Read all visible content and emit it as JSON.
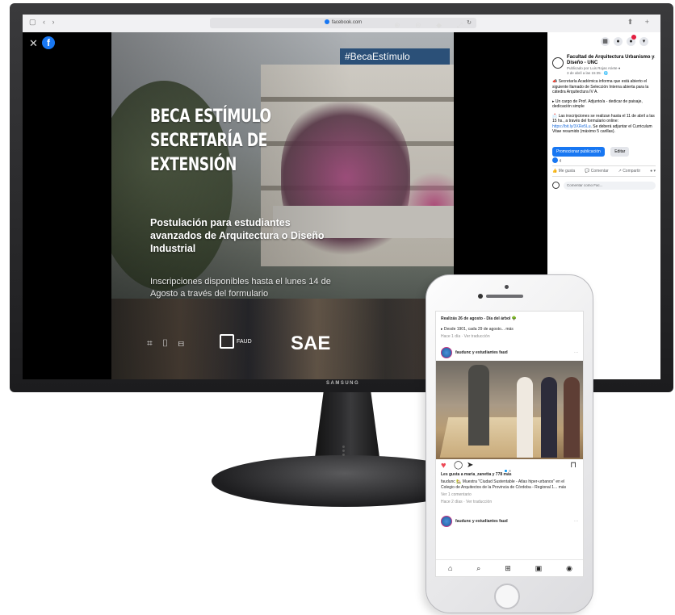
{
  "browser": {
    "url": "facebook.com",
    "nav_icons": "▢ ‹ ›",
    "right_icons": "⬆ +"
  },
  "viewer": {
    "close_icon": "✕",
    "logo_letter": "f",
    "zoom_icons": "⊕ ⊖ ◆ ⤢",
    "hashtag": "#BecaEstímulo",
    "title_lines": [
      "BECA ESTÍMULO",
      "SECRETARÍA DE",
      "EXTENSIÓN"
    ],
    "subtitle": "Postulación para estudiantes avanzados de Arquitectura o Diseño Industrial",
    "inscription": "Inscripciones disponibles hasta el lunes 14 de Agosto a través del formulario",
    "logos_left": "⌗ ▯ ⊟",
    "falo_label": "FAUD",
    "sae_label": "SAE"
  },
  "sidebar": {
    "top_icons": [
      "▦",
      "●",
      "●",
      "▾"
    ],
    "page_name": "Facultad de Arquitectura Urbanismo y Diseño - UNC",
    "post_meta_1": "Publicado por Luis Rojas Ariete ●",
    "post_meta_2": "3 de abril a las 15:35 · 🌐",
    "more": "···",
    "paragraph_1": "📣 Secretaría Académica informa que está abierto el siguiente llamado de Selección Interna abierta para la cátedra Arquitectura IV A.",
    "paragraph_2": "▸ Un cargo de Prof. Adjunto/a - dedicar de paisaje, dedicación simple",
    "paragraph_3_text": "📩 Las inscripciones se realizan hasta el 11 de abril a las 15 hs., a través del formulario online:",
    "paragraph_3_link": "https://bit.ly/3XRe5Lu",
    "paragraph_3_tail": ". Se deberá adjuntar el Curriculum Vitae resumido (máximo 5 carillas).",
    "promote_label": "Promocionar publicación",
    "edit_label": "Editar",
    "reaction_count": "4",
    "actions": [
      "👍 Me gusta",
      "💬 Comentar",
      "↗ Compartir",
      "● ▾"
    ],
    "comment_placeholder": "Comentar como Fac..."
  },
  "monitor": {
    "brand": "SAMSUNG"
  },
  "phone": {
    "post1_line1": "Realizás 26 de agosto - Día del árbol 🌳",
    "post1_line2": "▸ Desde 1901, cada 29 de agosto... más",
    "post1_meta_a": "Hace 1 día",
    "post1_meta_b": "Ver traducción",
    "account": "faudunc y estudiantes faud",
    "more": "···",
    "likes": "Les gusta a maria_zanetta y 778 más",
    "caption": "faudunc 🏡 Muestra \"Ciudad Sustentable - Atlas hiper-urbanos\" en el Colegio de Arquitectos de la Provincia de Córdoba - Regional 1... más",
    "comments_link": "Ver 1 comentario",
    "post2_meta_a": "Hace 2 días",
    "post2_meta_b": "Ver traducción",
    "account2": "faudunc y estudiantes faud",
    "nav_icons": [
      "⌂",
      "⌕",
      "⊞",
      "▣",
      "◉"
    ],
    "action_icons": {
      "heart": "♥",
      "comment": "◯",
      "share": "➤",
      "bookmark": "⊓"
    }
  },
  "colors": {
    "fb_blue": "#1877f2",
    "tag_bg": "#2b5078",
    "ig_heart": "#ed4956"
  }
}
